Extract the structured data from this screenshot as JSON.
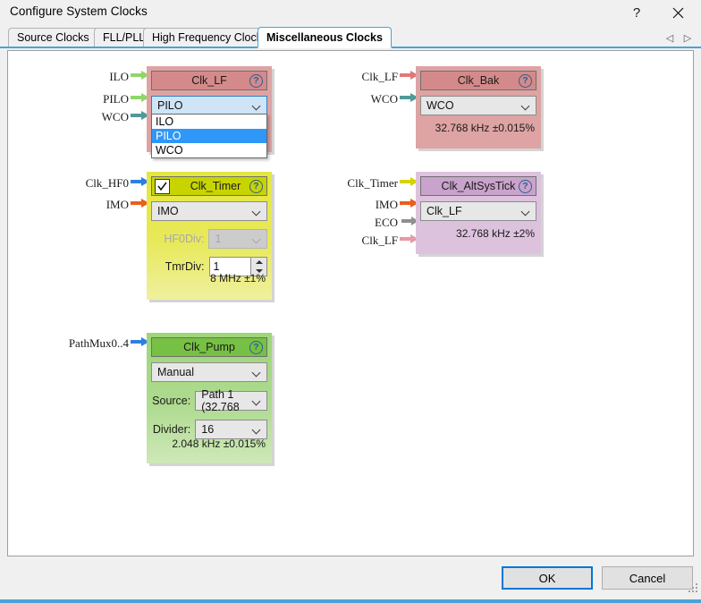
{
  "window": {
    "title": "Configure System Clocks",
    "help_label": "?",
    "close_label": "close-icon"
  },
  "tabs": {
    "items": [
      {
        "label": "Source Clocks",
        "active": false
      },
      {
        "label": "FLL/PLL",
        "active": false
      },
      {
        "label": "High Frequency Clocks",
        "active": false
      },
      {
        "label": "Miscellaneous Clocks",
        "active": true
      }
    ],
    "nav_prev": "◁",
    "nav_next": "▷"
  },
  "blocks": {
    "clk_lf": {
      "title": "Clk_LF",
      "help": "?",
      "combo_value": "PILO",
      "dropdown_open": true,
      "dropdown_options": [
        "ILO",
        "PILO",
        "WCO"
      ],
      "dropdown_selected": "PILO",
      "inputs": [
        {
          "label": "ILO",
          "color": "#8fd669"
        },
        {
          "label": "PILO",
          "color": "#8fd669"
        },
        {
          "label": "WCO",
          "color": "#4f9a9a"
        }
      ],
      "header_color": "#d48a8a",
      "body_color": "#dea3a3"
    },
    "clk_bak": {
      "title": "Clk_Bak",
      "help": "?",
      "combo_value": "WCO",
      "freq": "32.768 kHz ±0.015%",
      "inputs": [
        {
          "label": "Clk_LF",
          "color": "#e07878"
        },
        {
          "label": "WCO",
          "color": "#4f9a9a"
        }
      ],
      "header_color": "#d48a8a",
      "body_color": "#dea3a3"
    },
    "clk_timer": {
      "title": "Clk_Timer",
      "help": "?",
      "enabled": true,
      "checkbox_label": "enabled-checkbox",
      "combo_value": "IMO",
      "hf0div_label": "HF0Div:",
      "hf0div_value": "1",
      "hf0div_disabled": true,
      "tmrdiv_label": "TmrDiv:",
      "tmrdiv_value": "1",
      "freq": "8 MHz ±1%",
      "inputs": [
        {
          "label": "Clk_HF0",
          "color": "#2f7fe0"
        },
        {
          "label": "IMO",
          "color": "#e8601c"
        }
      ],
      "header_color": "#c8d400",
      "body_color": "#e6e84a"
    },
    "clk_altsystick": {
      "title": "Clk_AltSysTick",
      "help": "?",
      "combo_value": "Clk_LF",
      "freq": "32.768 kHz ±2%",
      "inputs": [
        {
          "label": "Clk_Timer",
          "color": "#d4d400"
        },
        {
          "label": "IMO",
          "color": "#e8601c"
        },
        {
          "label": "ECO",
          "color": "#8f8f8f"
        },
        {
          "label": "Clk_LF",
          "color": "#e49aa8"
        }
      ],
      "header_color": "#c9a3cb",
      "body_color": "#ddc2de"
    },
    "clk_pump": {
      "title": "Clk_Pump",
      "help": "?",
      "combo_value": "Manual",
      "source_label": "Source:",
      "source_value": "Path 1 (32.768",
      "divider_label": "Divider:",
      "divider_value": "16",
      "freq": "2.048 kHz ±0.015%",
      "inputs": [
        {
          "label": "PathMux0..4",
          "color": "#2f7fe0"
        }
      ],
      "header_color": "#76c043",
      "body_color": "#a9d98a"
    }
  },
  "footer": {
    "ok_label": "OK",
    "cancel_label": "Cancel"
  }
}
